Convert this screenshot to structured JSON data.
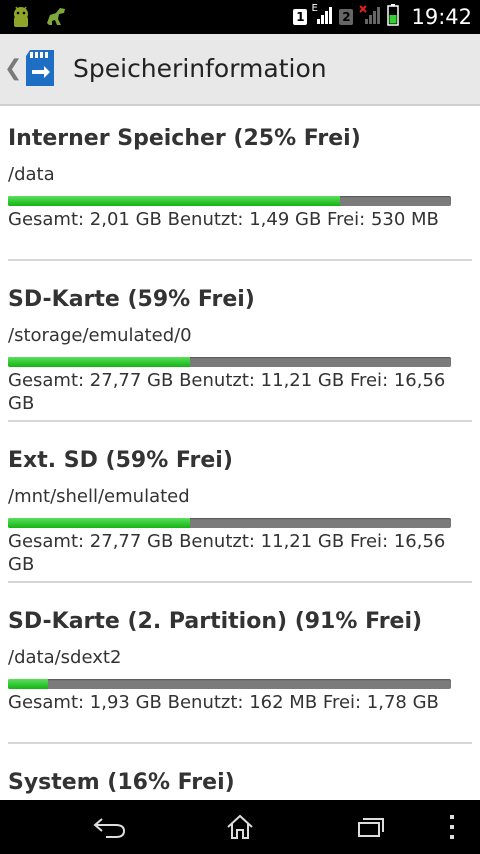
{
  "status_bar": {
    "time": "19:42",
    "sim1": "1",
    "sim2": "2",
    "network_type": "E"
  },
  "action_bar": {
    "title": "Speicherinformation"
  },
  "sections": [
    {
      "title": "Interner Speicher (25% Frei)",
      "path": "/data",
      "used_fraction": 0.75,
      "stats": "Gesamt: 2,01 GB Benutzt: 1,49 GB Frei: 530 MB"
    },
    {
      "title": "SD-Karte (59% Frei)",
      "path": "/storage/emulated/0",
      "used_fraction": 0.41,
      "stats": "Gesamt: 27,77 GB Benutzt: 11,21 GB Frei: 16,56 GB"
    },
    {
      "title": "Ext. SD (59% Frei)",
      "path": "/mnt/shell/emulated",
      "used_fraction": 0.41,
      "stats": "Gesamt: 27,77 GB Benutzt: 11,21 GB Frei: 16,56 GB"
    },
    {
      "title": "SD-Karte (2. Partition) (91% Frei)",
      "path": "/data/sdext2",
      "used_fraction": 0.09,
      "stats": "Gesamt: 1,93 GB Benutzt: 162 MB Frei: 1,78 GB"
    },
    {
      "title": "System (16% Frei)"
    }
  ],
  "colors": {
    "bar_used": "#22c422",
    "bar_free": "#7b7b7b",
    "action_bar": "#e8e8e8"
  },
  "icons": {
    "notification_1": "android-icon",
    "notification_2": "dinosaur-icon",
    "signal": "signal-icon",
    "battery": "battery-icon",
    "nav_back": "back-icon",
    "nav_home": "home-icon",
    "nav_recent": "recent-apps-icon",
    "nav_menu": "menu-dots-icon"
  }
}
